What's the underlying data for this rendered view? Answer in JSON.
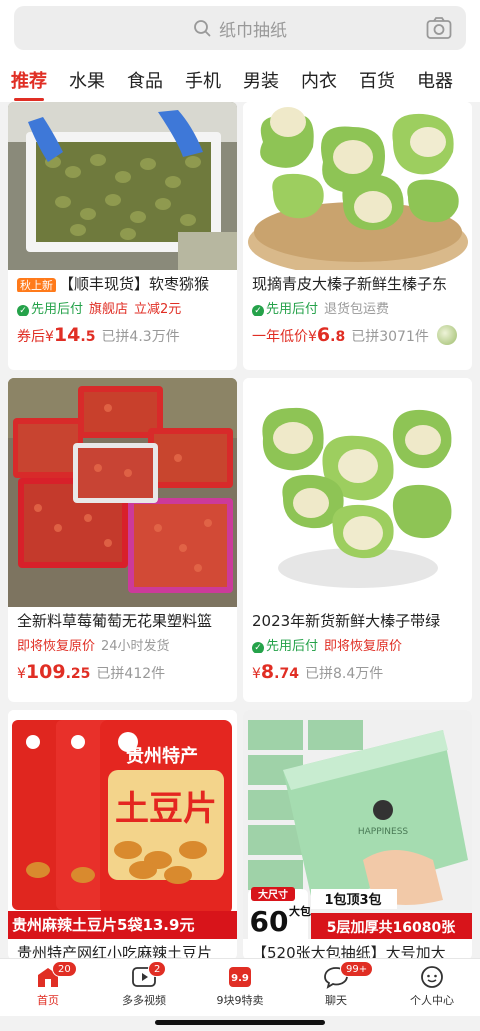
{
  "search": {
    "placeholder": "纸巾抽纸",
    "icons": [
      "search-icon",
      "camera-icon"
    ]
  },
  "tabs": [
    "推荐",
    "水果",
    "食品",
    "手机",
    "男装",
    "内衣",
    "百货",
    "电器"
  ],
  "products": [
    {
      "title": "【顺丰现货】软枣猕猴",
      "new_badge": "秋上新",
      "tags": [
        {
          "text": "先用后付",
          "style": "green"
        },
        {
          "text": "旗舰店",
          "style": "red"
        },
        {
          "text": "立减2元",
          "style": "red"
        }
      ],
      "price_prefix": "券后",
      "yen": "¥",
      "price_int": "14",
      "price_dec": ".5",
      "sold": "已拼4.3万件"
    },
    {
      "title": "现摘青皮大榛子新鲜生榛子东",
      "tags": [
        {
          "text": "先用后付",
          "style": "green"
        },
        {
          "text": "退货包运费",
          "style": "gray"
        }
      ],
      "price_prefix": "一年低价",
      "yen": "¥",
      "price_int": "6",
      "price_dec": ".8",
      "sold": "已拼3071件"
    },
    {
      "title": "全新料草莓葡萄无花果塑料篮",
      "tags": [
        {
          "text": "即将恢复原价",
          "style": "red"
        },
        {
          "text": "24小时发货",
          "style": "gray"
        }
      ],
      "price_prefix": "",
      "yen": "¥",
      "price_int": "109",
      "price_dec": ".25",
      "sold": "已拼412件"
    },
    {
      "title": "2023年新货新鲜大榛子带绿",
      "tags": [
        {
          "text": "先用后付",
          "style": "green"
        },
        {
          "text": "即将恢复原价",
          "style": "red"
        }
      ],
      "price_prefix": "",
      "yen": "¥",
      "price_int": "8",
      "price_dec": ".74",
      "sold": "已拼8.4万件"
    },
    {
      "title": "贵州特产网红小吃麻辣土豆片",
      "banner": "贵州麻辣土豆片5袋13.9元",
      "pkg_text": "贵州特产",
      "pkg_big": "土豆片"
    },
    {
      "title": "【520张大包抽纸】大号加大",
      "banner_left_small": "大尺寸",
      "banner_left_big": "60",
      "banner_left_unit": "大包",
      "banner_right_top": "1包顶3包",
      "banner_right_bottom": "5层加厚共16080张",
      "pkg_text": "HAPPINESS"
    }
  ],
  "nav": [
    {
      "label": "首页",
      "icon": "home-icon",
      "badge": "20",
      "active": true
    },
    {
      "label": "多多视频",
      "icon": "video-icon",
      "badge": "2",
      "active": false
    },
    {
      "label": "9块9特卖",
      "icon": "sale-icon",
      "badge": "",
      "active": false
    },
    {
      "label": "聊天",
      "icon": "chat-icon",
      "badge": "99+",
      "active": false
    },
    {
      "label": "个人中心",
      "icon": "profile-icon",
      "badge": "",
      "active": false
    }
  ],
  "colors": {
    "accent": "#e02e24",
    "green": "#25a24a"
  }
}
